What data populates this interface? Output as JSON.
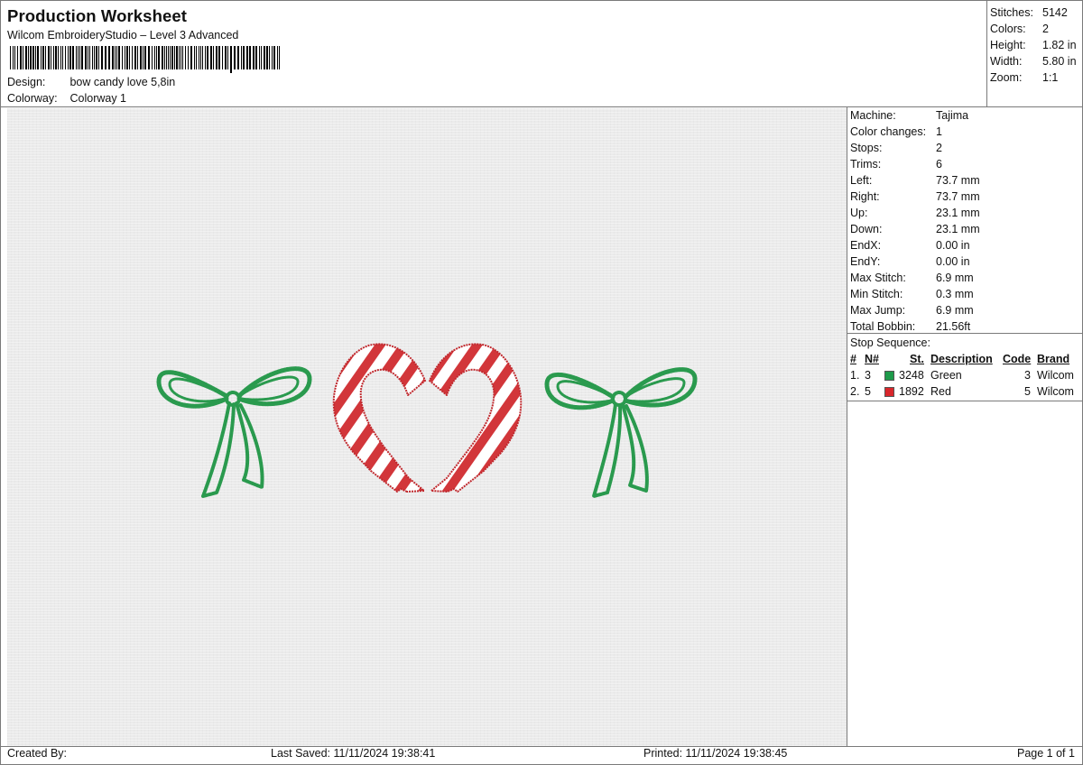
{
  "header": {
    "title": "Production Worksheet",
    "subtitle": "Wilcom EmbroideryStudio – Level 3 Advanced",
    "design_label": "Design:",
    "design_value": "bow candy love 5,8in",
    "colorway_label": "Colorway:",
    "colorway_value": "Colorway 1"
  },
  "summary": {
    "stitches_label": "Stitches:",
    "stitches_value": "5142",
    "colors_label": "Colors:",
    "colors_value": "2",
    "height_label": "Height:",
    "height_value": "1.82 in",
    "width_label": "Width:",
    "width_value": "5.80 in",
    "zoom_label": "Zoom:",
    "zoom_value": "1:1"
  },
  "info": {
    "machine_label": "Machine:",
    "machine_value": "Tajima",
    "color_changes_label": "Color changes:",
    "color_changes_value": "1",
    "stops_label": "Stops:",
    "stops_value": "2",
    "trims_label": "Trims:",
    "trims_value": "6",
    "left_label": "Left:",
    "left_value": "73.7 mm",
    "right_label": "Right:",
    "right_value": "73.7 mm",
    "up_label": "Up:",
    "up_value": "23.1 mm",
    "down_label": "Down:",
    "down_value": "23.1 mm",
    "endx_label": "EndX:",
    "endx_value": "0.00 in",
    "endy_label": "EndY:",
    "endy_value": "0.00 in",
    "max_stitch_label": "Max Stitch:",
    "max_stitch_value": "6.9 mm",
    "min_stitch_label": "Min Stitch:",
    "min_stitch_value": "0.3 mm",
    "max_jump_label": "Max Jump:",
    "max_jump_value": "6.9 mm",
    "total_bobbin_label": "Total Bobbin:",
    "total_bobbin_value": "21.56ft"
  },
  "stop_sequence": {
    "title": "Stop Sequence:",
    "headers": {
      "num": "#",
      "n": "N#",
      "st": "St.",
      "description": "Description",
      "code": "Code",
      "brand": "Brand"
    },
    "rows": [
      {
        "num": "1.",
        "n": "3",
        "st": "3248",
        "description": "Green",
        "code": "3",
        "brand": "Wilcom",
        "color": "#1e9a4a"
      },
      {
        "num": "2.",
        "n": "5",
        "st": "1892",
        "description": "Red",
        "code": "5",
        "brand": "Wilcom",
        "color": "#d8262b"
      }
    ]
  },
  "footer": {
    "created_by": "Created By:",
    "last_saved": "Last Saved: 11/11/2024 19:38:41",
    "printed": "Printed: 11/11/2024 19:38:45",
    "page": "Page 1 of 1"
  },
  "colors": {
    "green": "#2a9a4e",
    "red": "#d2363a",
    "canvas": "#ebebeb"
  }
}
